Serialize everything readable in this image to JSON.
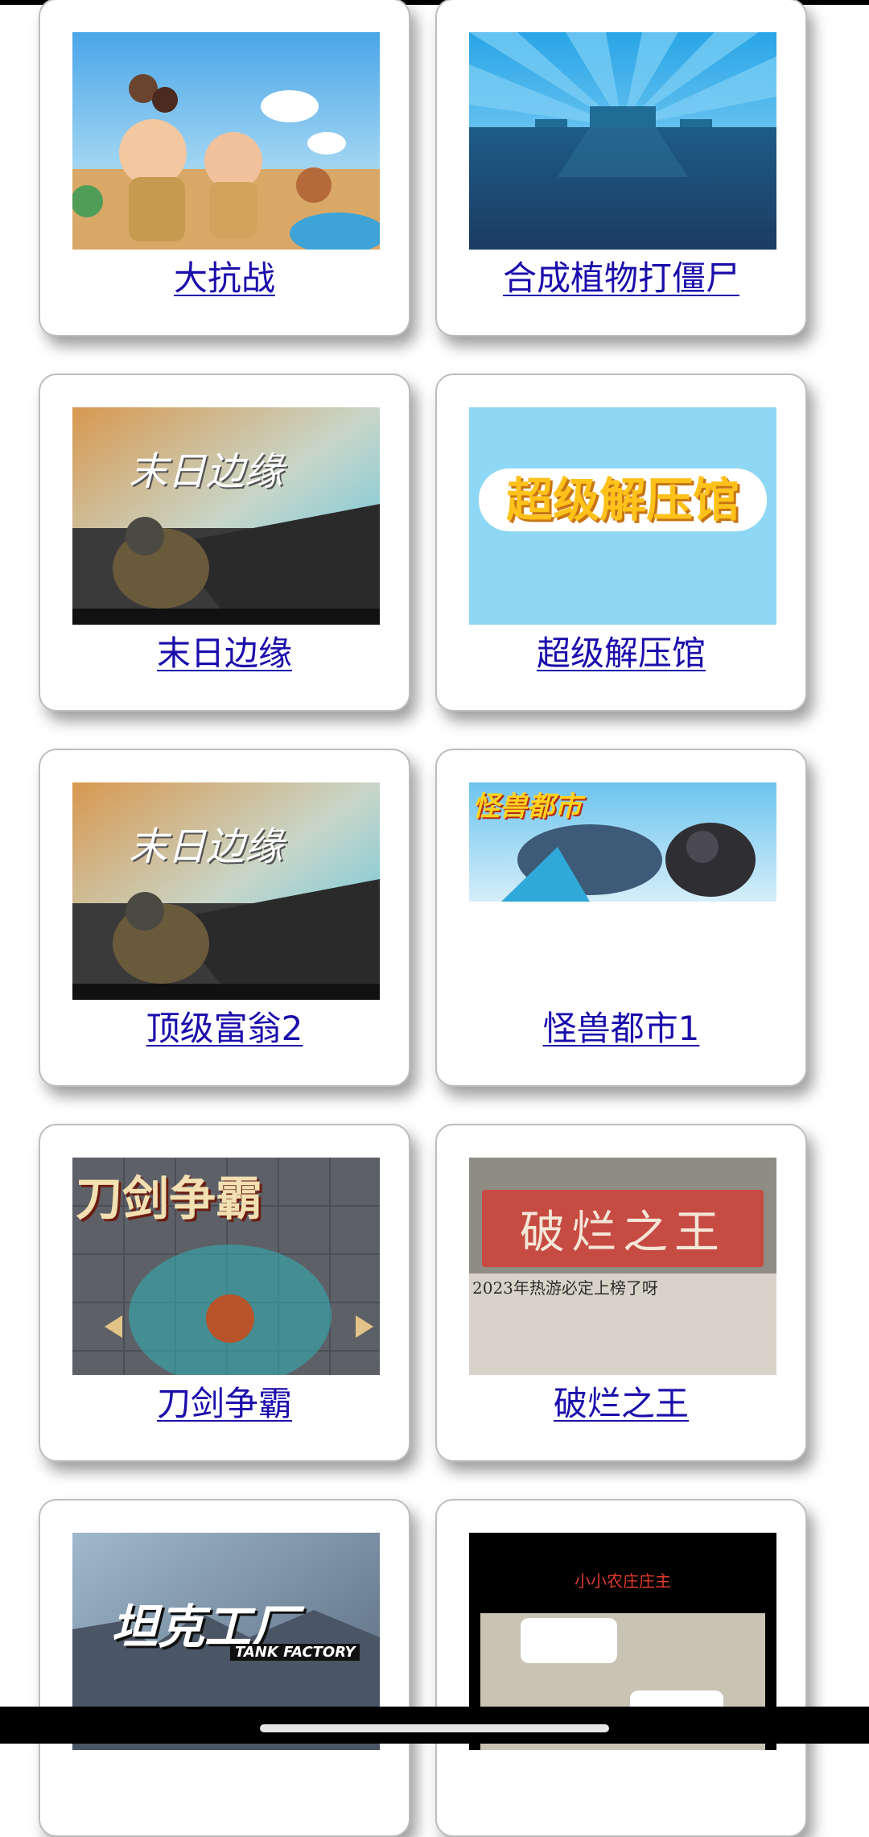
{
  "cards": [
    {
      "title": "大抗战",
      "image": "cartoon-war-game-thumbnail"
    },
    {
      "title": "合成植物打僵尸",
      "image": "blue-field-game-thumbnail"
    },
    {
      "title": "末日边缘",
      "image_text": "末日边缘",
      "image": "doomsday-edge-thumbnail"
    },
    {
      "title": "超级解压馆",
      "image_text": "超级解压馆",
      "image": "super-decompress-thumbnail"
    },
    {
      "title": "顶级富翁2",
      "image_text": "末日边缘",
      "image": "doomsday-edge-thumbnail"
    },
    {
      "title": "怪兽都市1",
      "image_text": "怪兽都市",
      "image": "monster-city-thumbnail"
    },
    {
      "title": "刀剑争霸",
      "image_text": "刀剑争霸",
      "image": "sword-battle-thumbnail"
    },
    {
      "title": "破烂之王",
      "image_text": "破烂之王",
      "image_subtext": "2023年热游必定上榜了呀",
      "image": "junk-king-thumbnail"
    },
    {
      "title": "",
      "image_text": "坦克工厂",
      "image_subtext": "TANK FACTORY",
      "image": "tank-factory-thumbnail"
    },
    {
      "title": "",
      "image_text": "小小农庄庄主",
      "image": "little-farm-thumbnail"
    }
  ],
  "colors": {
    "link": "#1a0dab",
    "card_border": "#bdbdbd"
  }
}
